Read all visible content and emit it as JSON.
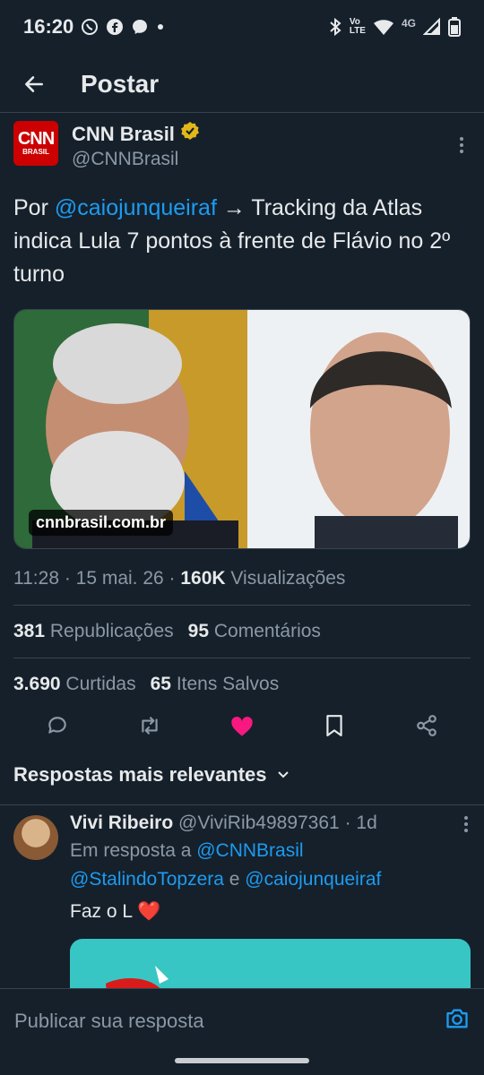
{
  "status_bar": {
    "time": "16:20",
    "network": "4G"
  },
  "header": {
    "title": "Postar"
  },
  "post": {
    "author_name": "CNN Brasil",
    "author_handle": "@CNNBrasil",
    "logo_text": "CNN",
    "logo_subtext": "BRASIL",
    "text_prefix": "Por ",
    "text_mention": "@caiojunqueiraf",
    "text_body": " → Tracking da Atlas indica Lula 7 pontos à frente de Flávio no 2º turno",
    "media_source": "cnnbrasil.com.br",
    "meta_time": "11:28 · 15 mai. 26 · ",
    "views_count": "160K",
    "views_label": " Visualizações",
    "reposts_count": "381",
    "reposts_label": "Republicações",
    "comments_count": "95",
    "comments_label": "Comentários",
    "likes_count": "3.690",
    "likes_label": "Curtidas",
    "saves_count": "65",
    "saves_label": "Itens Salvos"
  },
  "relevance": {
    "label": "Respostas mais relevantes"
  },
  "reply": {
    "name": "Vivi Ribeiro",
    "handle": "@ViviRib49897361",
    "time": " · 1d",
    "in_reply_to_prefix": "Em resposta a ",
    "in_reply_to_1": "@CNNBrasil",
    "in_reply_to_2": "@StalindoTopzera",
    "in_reply_to_conj": " e ",
    "in_reply_to_3": "@caiojunqueiraf",
    "text": "Faz o L ❤️"
  },
  "composer": {
    "placeholder": "Publicar sua resposta"
  },
  "colors": {
    "background": "#15202b",
    "accent": "#1d9bf0",
    "like": "#f91880",
    "brand_red": "#cc0000",
    "verified": "#e2b719"
  }
}
